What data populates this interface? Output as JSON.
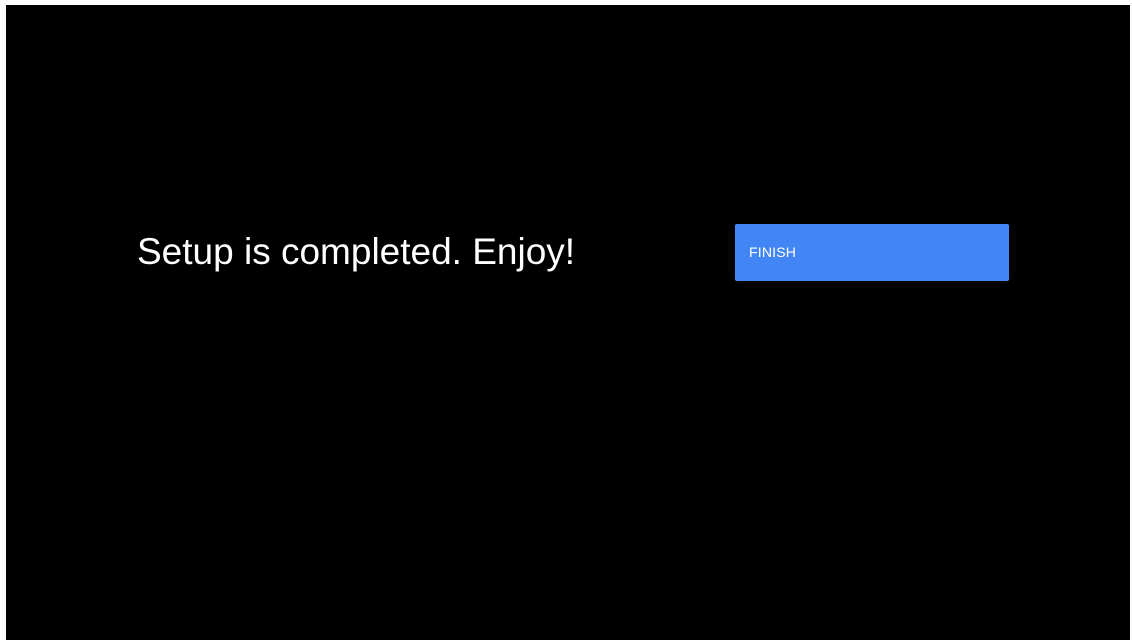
{
  "screen": {
    "background_color": "#000000",
    "message": "Setup is completed. Enjoy!",
    "finish_button": {
      "label": "FINISH",
      "color": "#4285f4"
    }
  }
}
